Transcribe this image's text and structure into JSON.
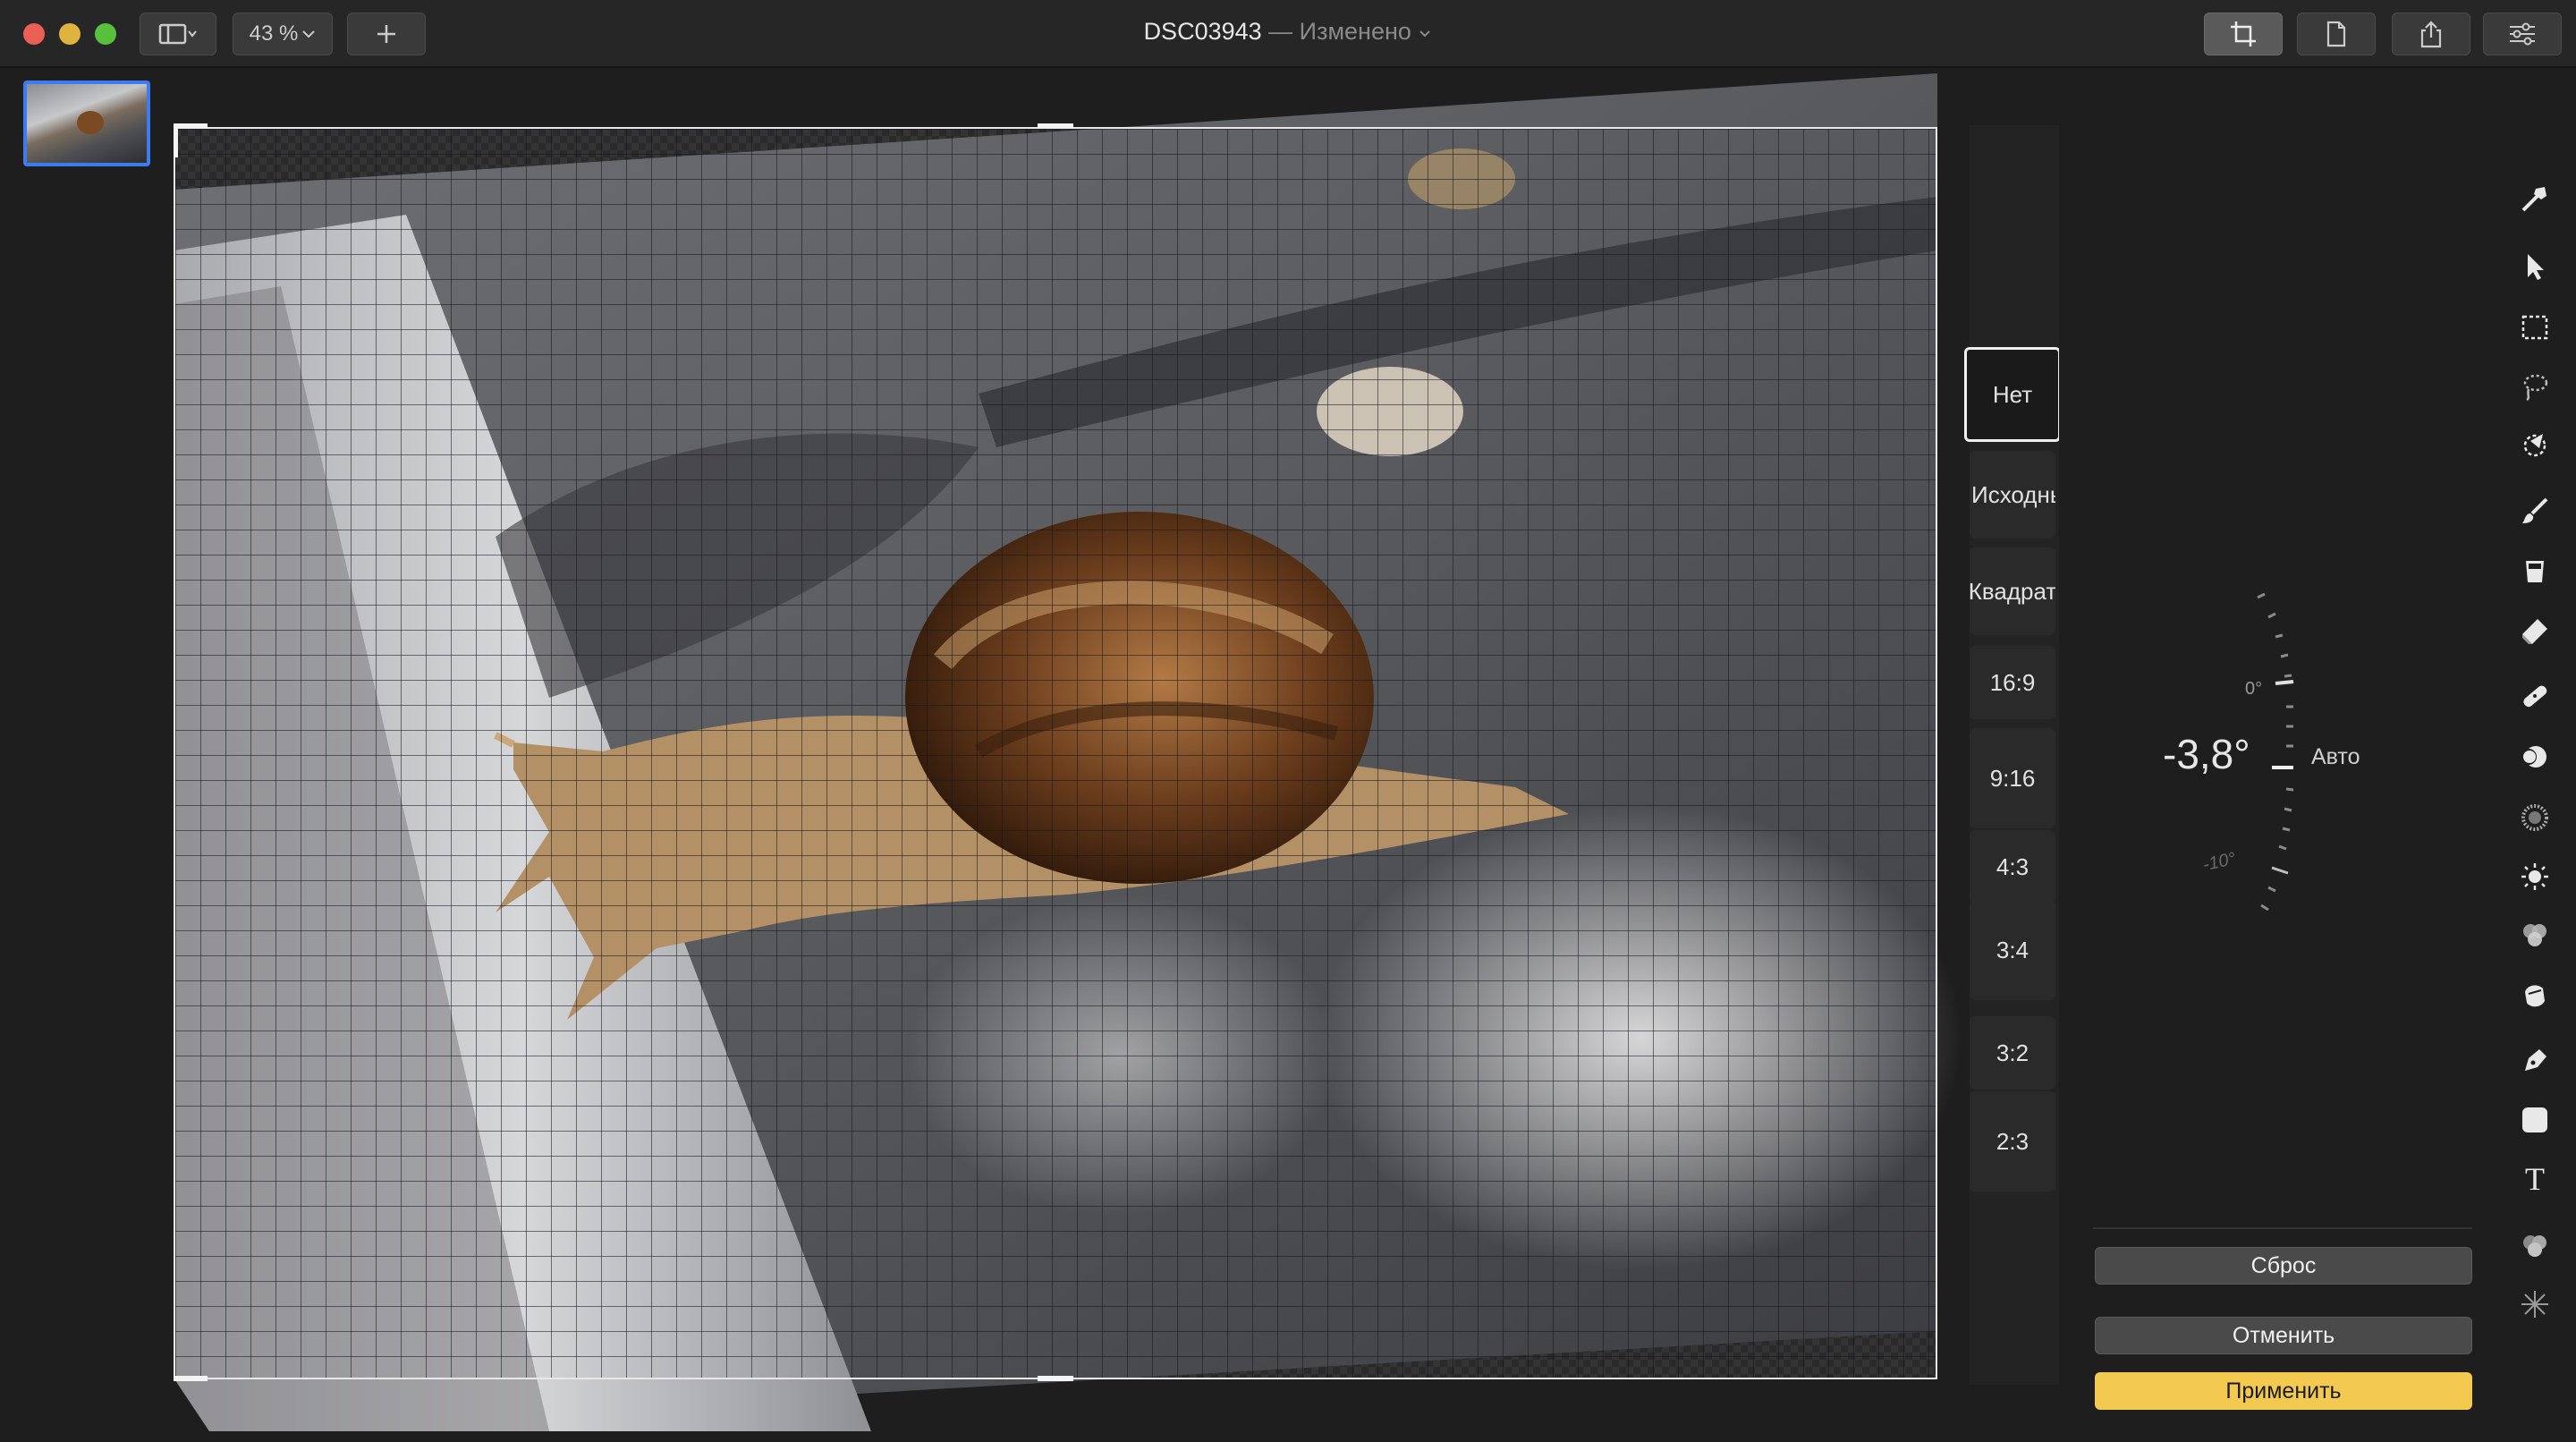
{
  "window": {
    "title": "DSC03943",
    "subtitle": "— Изменено",
    "zoom": "43 %"
  },
  "aspect_ratios": [
    {
      "label": "Нет",
      "selected": true
    },
    {
      "label": "Исходный"
    },
    {
      "label": "Квадрат"
    },
    {
      "label": "16:9"
    },
    {
      "label": "9:16"
    },
    {
      "label": "4:3"
    },
    {
      "label": "3:4"
    },
    {
      "label": "3:2"
    },
    {
      "label": "2:3"
    }
  ],
  "rotation": {
    "angle_label": "-3,8°",
    "auto_label": "Авто",
    "dial_labels": [
      "0°",
      "-10°"
    ]
  },
  "actions": {
    "reset": "Сброс",
    "cancel": "Отменить",
    "apply": "Применить"
  },
  "tools": [
    "wand-icon",
    "arrow-pointer-icon",
    "rect-selection-icon",
    "lasso-icon",
    "magic-selection-icon",
    "brush-icon",
    "bucket-icon",
    "eraser-icon",
    "bandage-icon",
    "clone-stamp-icon",
    "blur-icon",
    "light-icon",
    "color-icon",
    "smudge-icon",
    "pen-icon",
    "shape-icon",
    "text-icon",
    "effects-icon",
    "sparkle-icon"
  ],
  "tool_text": {
    "text_tool": "T"
  },
  "colors": {
    "accent": "#f3c94f",
    "selection": "#3c7cf0"
  }
}
